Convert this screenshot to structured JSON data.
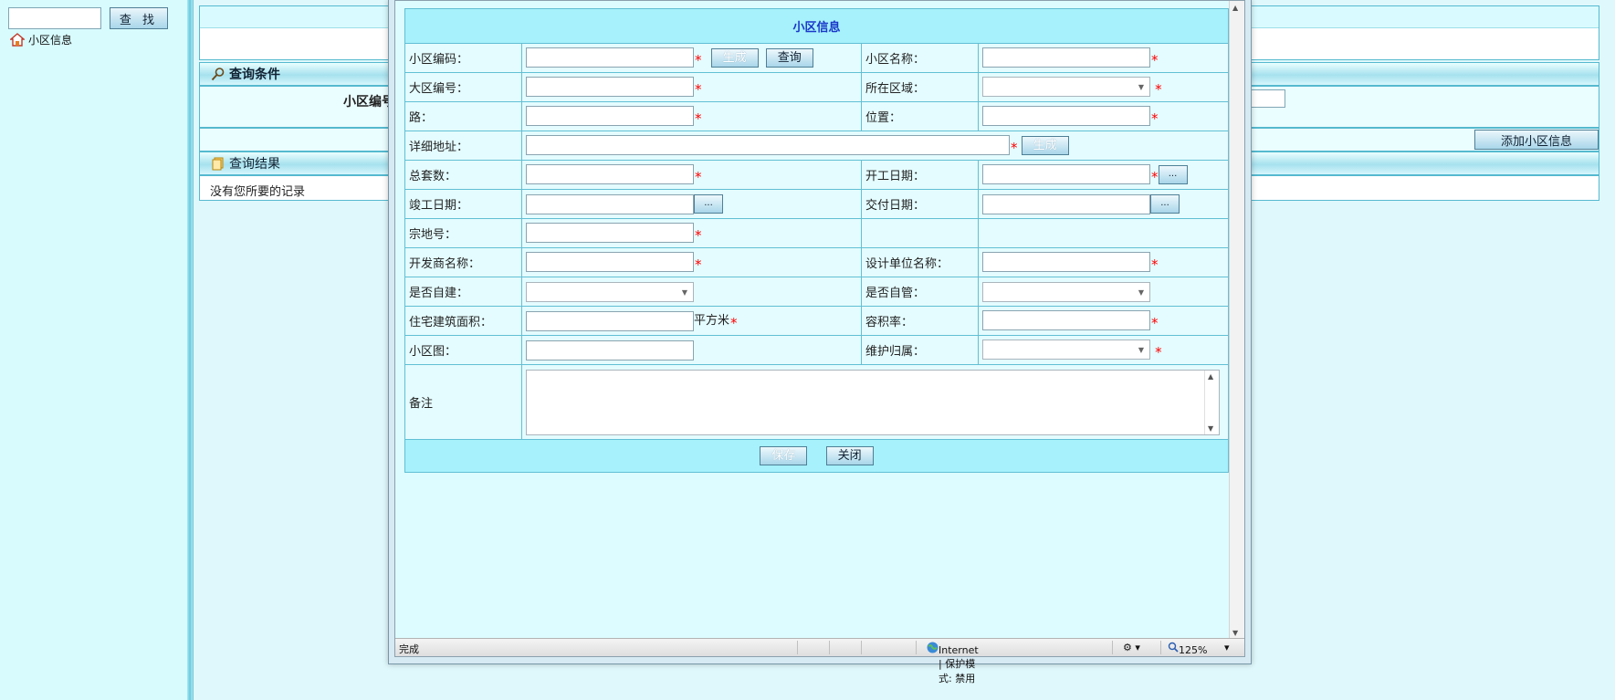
{
  "left_panel": {
    "search_button": "查 找",
    "tree_item_label": "小区信息"
  },
  "main": {
    "query_header": "查询条件",
    "query_label": "小区编号",
    "add_button": "添加小区信息",
    "result_header": "查询结果",
    "no_records": "没有您所要的记录"
  },
  "form": {
    "title": "小区信息",
    "fields": {
      "community_code": "小区编码：",
      "community_name": "小区名称：",
      "district_code": "大区编号：",
      "area": "所在区域：",
      "road": "路：",
      "position": "位置：",
      "address": "详细地址：",
      "total_units": "总套数：",
      "start_date": "开工日期：",
      "completion_date": "竣工日期：",
      "delivery_date": "交付日期：",
      "parcel_no": "宗地号：",
      "developer": "开发商名称：",
      "design_unit": "设计单位名称：",
      "self_built": "是否自建：",
      "self_managed": "是否自管：",
      "residential_area": "住宅建筑面积：",
      "plot_ratio": "容积率：",
      "community_map": "小区图：",
      "maintenance": "维护归属：",
      "remarks": "备注"
    },
    "unit_sqm": "平方米",
    "required_mark": "*",
    "generate_button": "生成",
    "query_button": "查询",
    "date_picker_button": "...",
    "save_button": "保存",
    "close_button": "关闭"
  },
  "status_bar": {
    "status": "完成",
    "zone": "Internet | 保护模式: 禁用",
    "zoom": "125%"
  }
}
